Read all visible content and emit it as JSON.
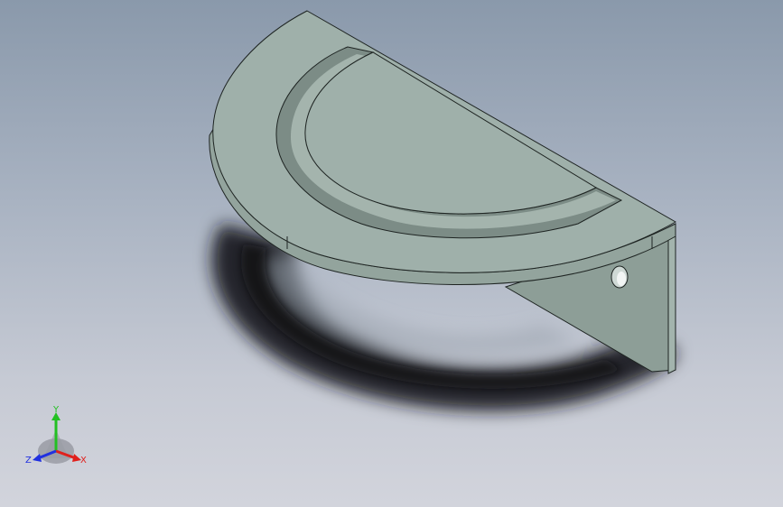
{
  "viewport": {
    "background_top": "#8a99ab",
    "background_bottom": "#d2d4dc"
  },
  "model": {
    "part_color": "#9fb0aa",
    "face_color_light": "#a9bab4",
    "face_color_dark": "#8f9f98",
    "edge_color": "#1e2422",
    "shadow_color": "#1a1c20"
  },
  "triad": {
    "x_label": "X",
    "y_label": "Y",
    "z_label": "Z",
    "x_color": "#e0201c",
    "y_color": "#22c022",
    "z_color": "#2030e0"
  }
}
